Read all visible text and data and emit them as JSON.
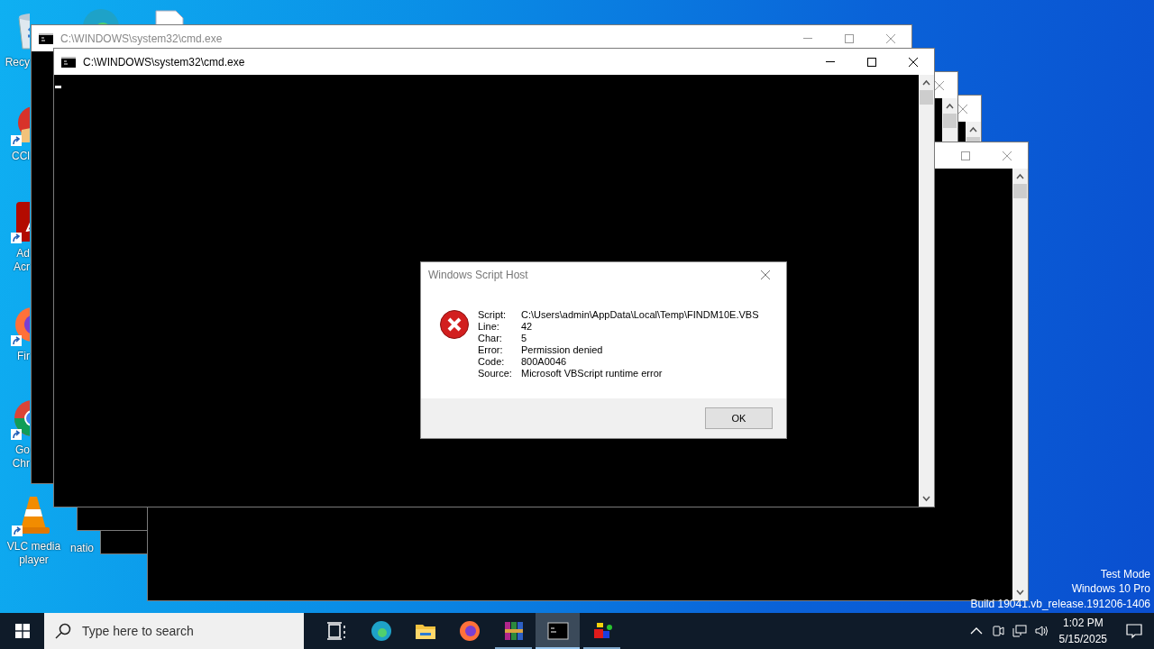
{
  "desktop_icons": [
    {
      "kind": "recycle-bin",
      "label_lines": [
        "Recy"
      ],
      "shortcut": false
    },
    {
      "kind": "broom",
      "label_lines": [
        "CCl"
      ],
      "shortcut": true
    },
    {
      "kind": "acrobat",
      "label_lines": [
        "Ad",
        "Acr"
      ],
      "shortcut": true
    },
    {
      "kind": "firefox",
      "label_lines": [
        "Fir"
      ],
      "shortcut": true
    },
    {
      "kind": "chrome",
      "label_lines": [
        "Go",
        "Chr"
      ],
      "shortcut": true
    },
    {
      "kind": "vlc",
      "label_lines": [
        "VLC media",
        "player"
      ],
      "shortcut": true
    },
    {
      "kind": "edge"
    },
    {
      "kind": "none",
      "label_lines": [
        "natio"
      ]
    },
    {
      "kind": "document"
    }
  ],
  "windows": [
    {
      "title": "C:\\WINDOWS\\system32\\cmd.exe",
      "active": false,
      "controls": [
        {
          "kind": "minimize"
        },
        {
          "kind": "maximize"
        },
        {
          "kind": "close"
        }
      ]
    },
    {
      "title": "C:\\WINDOWS\\system32\\cmd.exe",
      "active": true,
      "cursor": true,
      "controls": [
        {
          "kind": "minimize"
        },
        {
          "kind": "maximize"
        },
        {
          "kind": "close"
        }
      ]
    },
    {
      "active": false,
      "controls": [
        {
          "kind": "close"
        }
      ]
    },
    {
      "active": false,
      "controls": [
        {
          "kind": "close"
        }
      ]
    },
    {
      "active": false,
      "controls": [
        {
          "kind": "maximize"
        },
        {
          "kind": "close"
        }
      ]
    }
  ],
  "dialog": {
    "title": "Windows Script Host",
    "fields": [
      {
        "label": "Script:",
        "value": "C:\\Users\\admin\\AppData\\Local\\Temp\\FINDM10E.VBS"
      },
      {
        "label": "Line:",
        "value": "42"
      },
      {
        "label": "Char:",
        "value": "5"
      },
      {
        "label": "Error:",
        "value": "Permission denied"
      },
      {
        "label": "Code:",
        "value": "800A0046"
      },
      {
        "label": "Source:",
        "value": "Microsoft VBScript runtime error"
      }
    ],
    "button": "OK"
  },
  "system_watermark": [
    "Test Mode",
    "Windows 10 Pro",
    "Build 19041.vb_release.191206-1406"
  ],
  "taskbar": {
    "search_placeholder": "Type here to search",
    "apps": [
      {
        "kind": "task-view",
        "selected": false,
        "running": false
      },
      {
        "kind": "edge",
        "selected": false,
        "running": false
      },
      {
        "kind": "folder",
        "selected": false,
        "running": false
      },
      {
        "kind": "firefox",
        "selected": false,
        "running": false
      },
      {
        "kind": "archive",
        "selected": false,
        "running": true
      },
      {
        "kind": "console",
        "selected": true,
        "running": true
      },
      {
        "kind": "blocks",
        "selected": false,
        "running": true
      }
    ],
    "time": "1:02 PM",
    "date": "5/15/2025"
  }
}
